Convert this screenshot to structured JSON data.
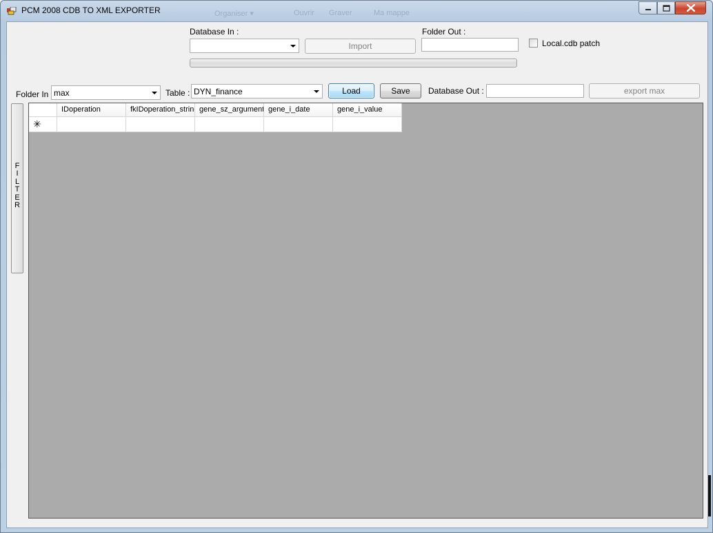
{
  "window": {
    "title": "PCM 2008 CDB TO XML EXPORTER",
    "background_ghost": [
      "Organiser ▾",
      "Ouvrir",
      "Graver",
      "Ma mappe"
    ]
  },
  "top_controls": {
    "database_in_label": "Database In :",
    "database_in_value": "",
    "import_label": "Import",
    "folder_out_label": "Folder Out :",
    "folder_out_value": "",
    "local_cdb_patch_label": "Local.cdb patch",
    "import_progress": 0
  },
  "toolbar": {
    "folder_in_label": "Folder In :",
    "folder_in_value": "max",
    "table_label": "Table :",
    "table_value": "DYN_finance",
    "load_label": "Load",
    "save_label": "Save",
    "database_out_label": "Database Out :",
    "database_out_value": "",
    "export_label": "export max"
  },
  "filter": {
    "label": "FILTER"
  },
  "grid": {
    "columns": [
      "IDoperation",
      "fkIDoperation_string",
      "gene_sz_argument",
      "gene_i_date",
      "gene_i_value"
    ],
    "new_row_marker": "✳"
  },
  "colors": {
    "grid_background": "#ababab",
    "client_background": "#f0f0f0",
    "close_button": "#c9452c",
    "focused_button": "#3c7fb1"
  }
}
